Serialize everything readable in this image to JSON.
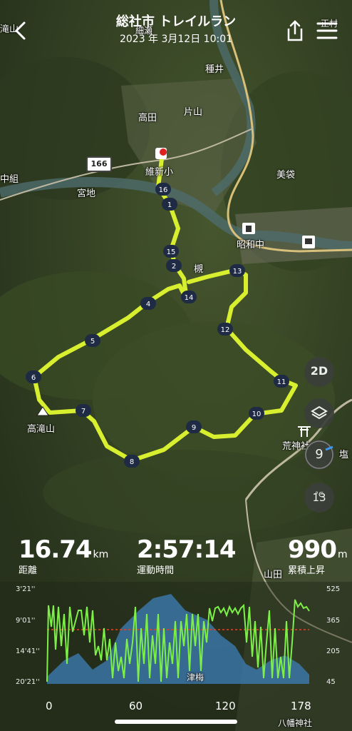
{
  "header": {
    "title": "総社市 トレイルラン",
    "subtitle": "2023 年 3月12日 10:01",
    "overlapping_labels": [
      "細瀬",
      "正村"
    ]
  },
  "map": {
    "places": [
      "高田",
      "片山",
      "種井",
      "維新小",
      "中組",
      "宮地",
      "美袋",
      "昭和中",
      "槻",
      "高滝山",
      "荒神社",
      "塩",
      "山田",
      "滝山"
    ],
    "road_number": "166",
    "markers": [
      "1",
      "2",
      "4",
      "5",
      "6",
      "7",
      "8",
      "9",
      "10",
      "11",
      "12",
      "13",
      "14",
      "15",
      "16"
    ]
  },
  "controls": {
    "mode_label": "2D",
    "layers_icon": "layers-icon",
    "compass_value": "9",
    "temperature": "13",
    "temperature_unit": "°C"
  },
  "stats": {
    "distance": {
      "value": "16.74",
      "unit": "km",
      "label": "距離"
    },
    "time": {
      "value": "2:57:14",
      "label": "運動時間"
    },
    "elevation": {
      "value": "990",
      "unit": "m",
      "label": "累積上昇"
    }
  },
  "chart_data": {
    "type": "area",
    "pace_axis_labels": [
      "3'21''",
      "9'01''",
      "14'41''",
      "20'21''"
    ],
    "elevation_axis_labels": [
      "525",
      "365",
      "205",
      "45"
    ],
    "x_ticks": [
      "0",
      "60",
      "120",
      "178"
    ],
    "map_labels": [
      "津梅",
      "八幡神社",
      "山田"
    ],
    "colors": {
      "pace": "#7cf047",
      "elevation": "#3e7fb8",
      "avg_line": "#d9482b"
    }
  }
}
